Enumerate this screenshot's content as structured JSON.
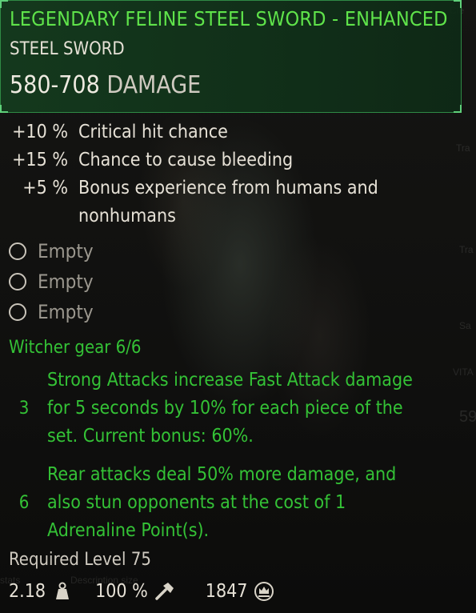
{
  "item": {
    "name": "LEGENDARY FELINE STEEL SWORD - ENHANCED",
    "type": "STEEL SWORD",
    "damage_value": "580-708",
    "damage_label": "DAMAGE"
  },
  "stats": [
    {
      "value": "+10 %",
      "text": "Critical hit chance"
    },
    {
      "value": "+15 %",
      "text": "Chance to cause bleeding"
    },
    {
      "value": "+5 %",
      "text": "Bonus experience from humans and nonhumans"
    }
  ],
  "sockets": [
    "Empty",
    "Empty",
    "Empty"
  ],
  "set": {
    "title": "Witcher gear 6/6",
    "bonuses": [
      {
        "pieces": "3",
        "text": "Strong Attacks increase Fast Attack damage for 5 seconds by 10% for each piece of the set. Current bonus: 60%."
      },
      {
        "pieces": "6",
        "text": "Rear attacks deal 50% more damage, and also stun opponents at the cost of 1 Adrenaline Point(s)."
      }
    ]
  },
  "required_level": "Required Level 75",
  "footer": {
    "weight": "2.18",
    "weight_icon": "weight-icon",
    "durability": "100 %",
    "durability_icon": "hammer-icon",
    "price": "1847",
    "price_icon": "crown-coin-icon"
  },
  "colors": {
    "rarity_green": "#5fe34a",
    "set_green": "#34c236",
    "header_bg": "#143c1e"
  }
}
